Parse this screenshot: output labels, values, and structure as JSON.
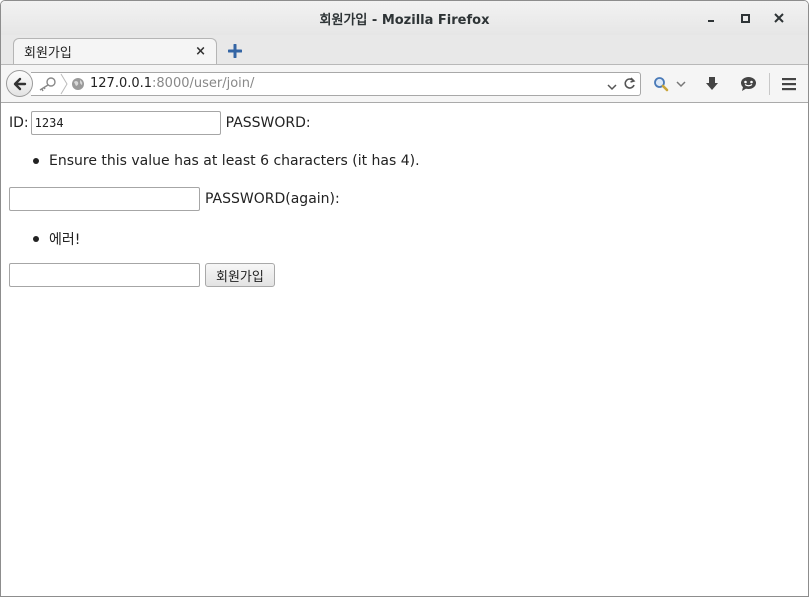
{
  "window": {
    "title": "회원가입 - Mozilla Firefox"
  },
  "tab": {
    "label": "회원가입",
    "close": "×"
  },
  "urlbar": {
    "host": "127.0.0.1",
    "port_path": ":8000/user/join/"
  },
  "icons": {
    "back": "back-arrow-icon",
    "identity": "key-icon",
    "site": "globe-icon",
    "dropdown": "chevron-down-icon",
    "reload": "reload-icon",
    "search": "search-icon",
    "downloads": "download-icon",
    "chat": "chat-icon",
    "menu": "hamburger-menu-icon",
    "newtab": "plus-icon"
  },
  "form": {
    "id_label": "ID:",
    "id_value": "1234",
    "password_label": "PASSWORD:",
    "password_error": "Ensure this value has at least 6 characters (it has 4).",
    "password_value": "",
    "password_again_label": "PASSWORD(again):",
    "password_again_error": "에러!",
    "password_again_value": "",
    "submit_label": "회원가입"
  }
}
